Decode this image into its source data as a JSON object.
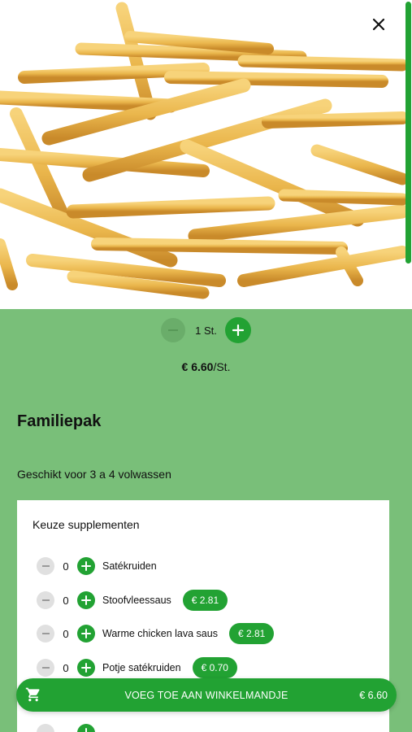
{
  "product": {
    "image_alt": "Friet",
    "quantity": "1 St.",
    "unit_price": "€ 6.60",
    "unit_suffix": "/St.",
    "title": "Familiepak",
    "description": "Geschikt voor 3 a 4 volwassen"
  },
  "supplements": {
    "heading": "Keuze supplementen",
    "items": [
      {
        "count": "0",
        "name": "Satékruiden",
        "price": ""
      },
      {
        "count": "0",
        "name": "Stoofvleessaus",
        "price": "€ 2.81"
      },
      {
        "count": "0",
        "name": "Warme chicken lava saus",
        "price": "€ 2.81"
      },
      {
        "count": "0",
        "name": "Potje satékruiden",
        "price": "€ 0.70"
      }
    ]
  },
  "cart": {
    "label": "VOEG TOE AAN WINKELMANDJE",
    "total": "€ 6.60"
  },
  "icons": {
    "close": "close-icon",
    "minus": "minus-icon",
    "plus": "plus-icon",
    "cart": "shopping-cart-icon"
  },
  "colors": {
    "accent": "#22a233",
    "background": "#79bf79",
    "card": "#ffffff"
  }
}
